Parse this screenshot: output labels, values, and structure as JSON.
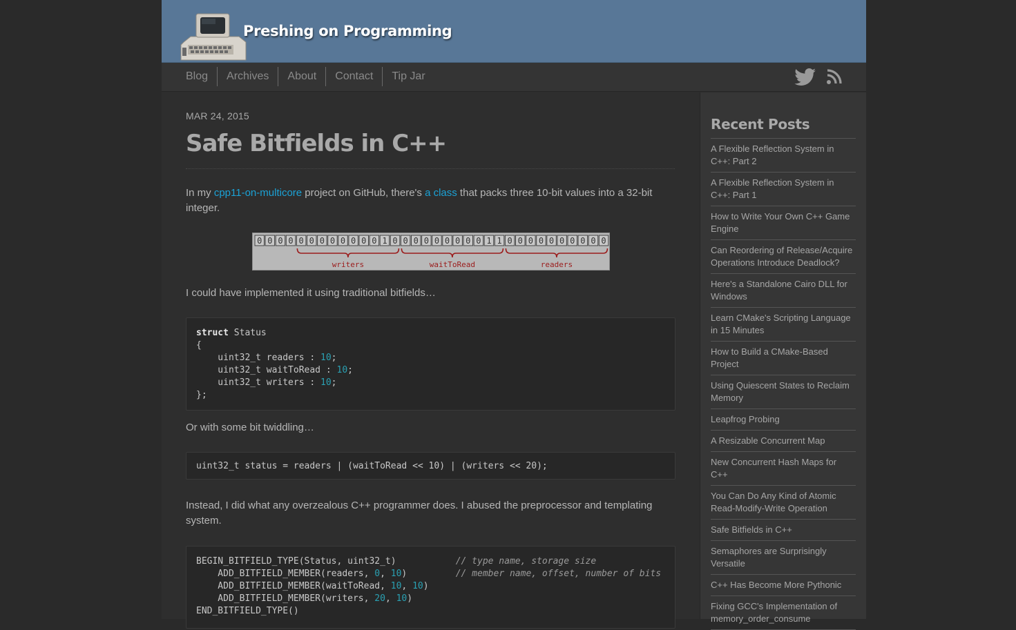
{
  "site": {
    "title": "Preshing on Programming"
  },
  "nav": {
    "items": [
      "Blog",
      "Archives",
      "About",
      "Contact",
      "Tip Jar"
    ],
    "icons": [
      "twitter-icon",
      "rss-icon"
    ]
  },
  "post": {
    "date": "MAR 24, 2015",
    "title": "Safe Bitfields in C++",
    "p1_before": "In my ",
    "p1_link1": "cpp11-on-multicore",
    "p1_mid": " project on GitHub, there's ",
    "p1_link2": "a class",
    "p1_after": " that packs three 10-bit values into a 32-bit integer.",
    "p2": "I could have implemented it using traditional bitfields…",
    "p3": "Or with some bit twiddling…",
    "p4": "Instead, I did what any overzealous C++ programmer does. I abused the preprocessor and templating system."
  },
  "diagram": {
    "bits": [
      "0",
      "0",
      "0",
      "0",
      "0",
      "0",
      "0",
      "0",
      "0",
      "0",
      "0",
      "0",
      "1",
      "0",
      "0",
      "0",
      "0",
      "0",
      "0",
      "0",
      "0",
      "0",
      "1",
      "1",
      "0",
      "0",
      "0",
      "0",
      "0",
      "0",
      "0",
      "0",
      "0",
      "0"
    ],
    "labels": [
      "writers",
      "waitToRead",
      "readers"
    ]
  },
  "code1": {
    "kw": "struct",
    "name": " Status",
    "open": "{",
    "line1": "    uint32_t readers : ",
    "line2": "    uint32_t waitToRead : ",
    "line3": "    uint32_t writers : ",
    "num": "10",
    "semi": ";",
    "close": "};"
  },
  "code2": {
    "a": "uint32_t status = readers | (waitToRead << 10) | (writers << 20);"
  },
  "code3": {
    "l1": "BEGIN_BITFIELD_TYPE(Status, uint32_t)           ",
    "c1": "// type name, storage size",
    "l2a": "    ADD_BITFIELD_MEMBER(readers, ",
    "l2b": "0",
    "l2c": ", ",
    "l2d": "10",
    "l2e": ")         ",
    "c2": "// member name, offset, number of bits",
    "l3a": "    ADD_BITFIELD_MEMBER(waitToRead, ",
    "l3b": "10",
    "l3c": ", ",
    "l3d": "10",
    "l3e": ")",
    "l4a": "    ADD_BITFIELD_MEMBER(writers, ",
    "l4b": "20",
    "l4c": ", ",
    "l4d": "10",
    "l4e": ")",
    "l5": "END_BITFIELD_TYPE()"
  },
  "sidebar": {
    "title": "Recent Posts",
    "posts": [
      "A Flexible Reflection System in C++: Part 2",
      "A Flexible Reflection System in C++: Part 1",
      "How to Write Your Own C++ Game Engine",
      "Can Reordering of Release/Acquire Operations Introduce Deadlock?",
      "Here's a Standalone Cairo DLL for Windows",
      "Learn CMake's Scripting Language in 15 Minutes",
      "How to Build a CMake-Based Project",
      "Using Quiescent States to Reclaim Memory",
      "Leapfrog Probing",
      "A Resizable Concurrent Map",
      "New Concurrent Hash Maps for C++",
      "You Can Do Any Kind of Atomic Read-Modify-Write Operation",
      "Safe Bitfields in C++",
      "Semaphores are Surprisingly Versatile",
      "C++ Has Become More Pythonic",
      "Fixing GCC's Implementation of memory_order_consume"
    ]
  }
}
